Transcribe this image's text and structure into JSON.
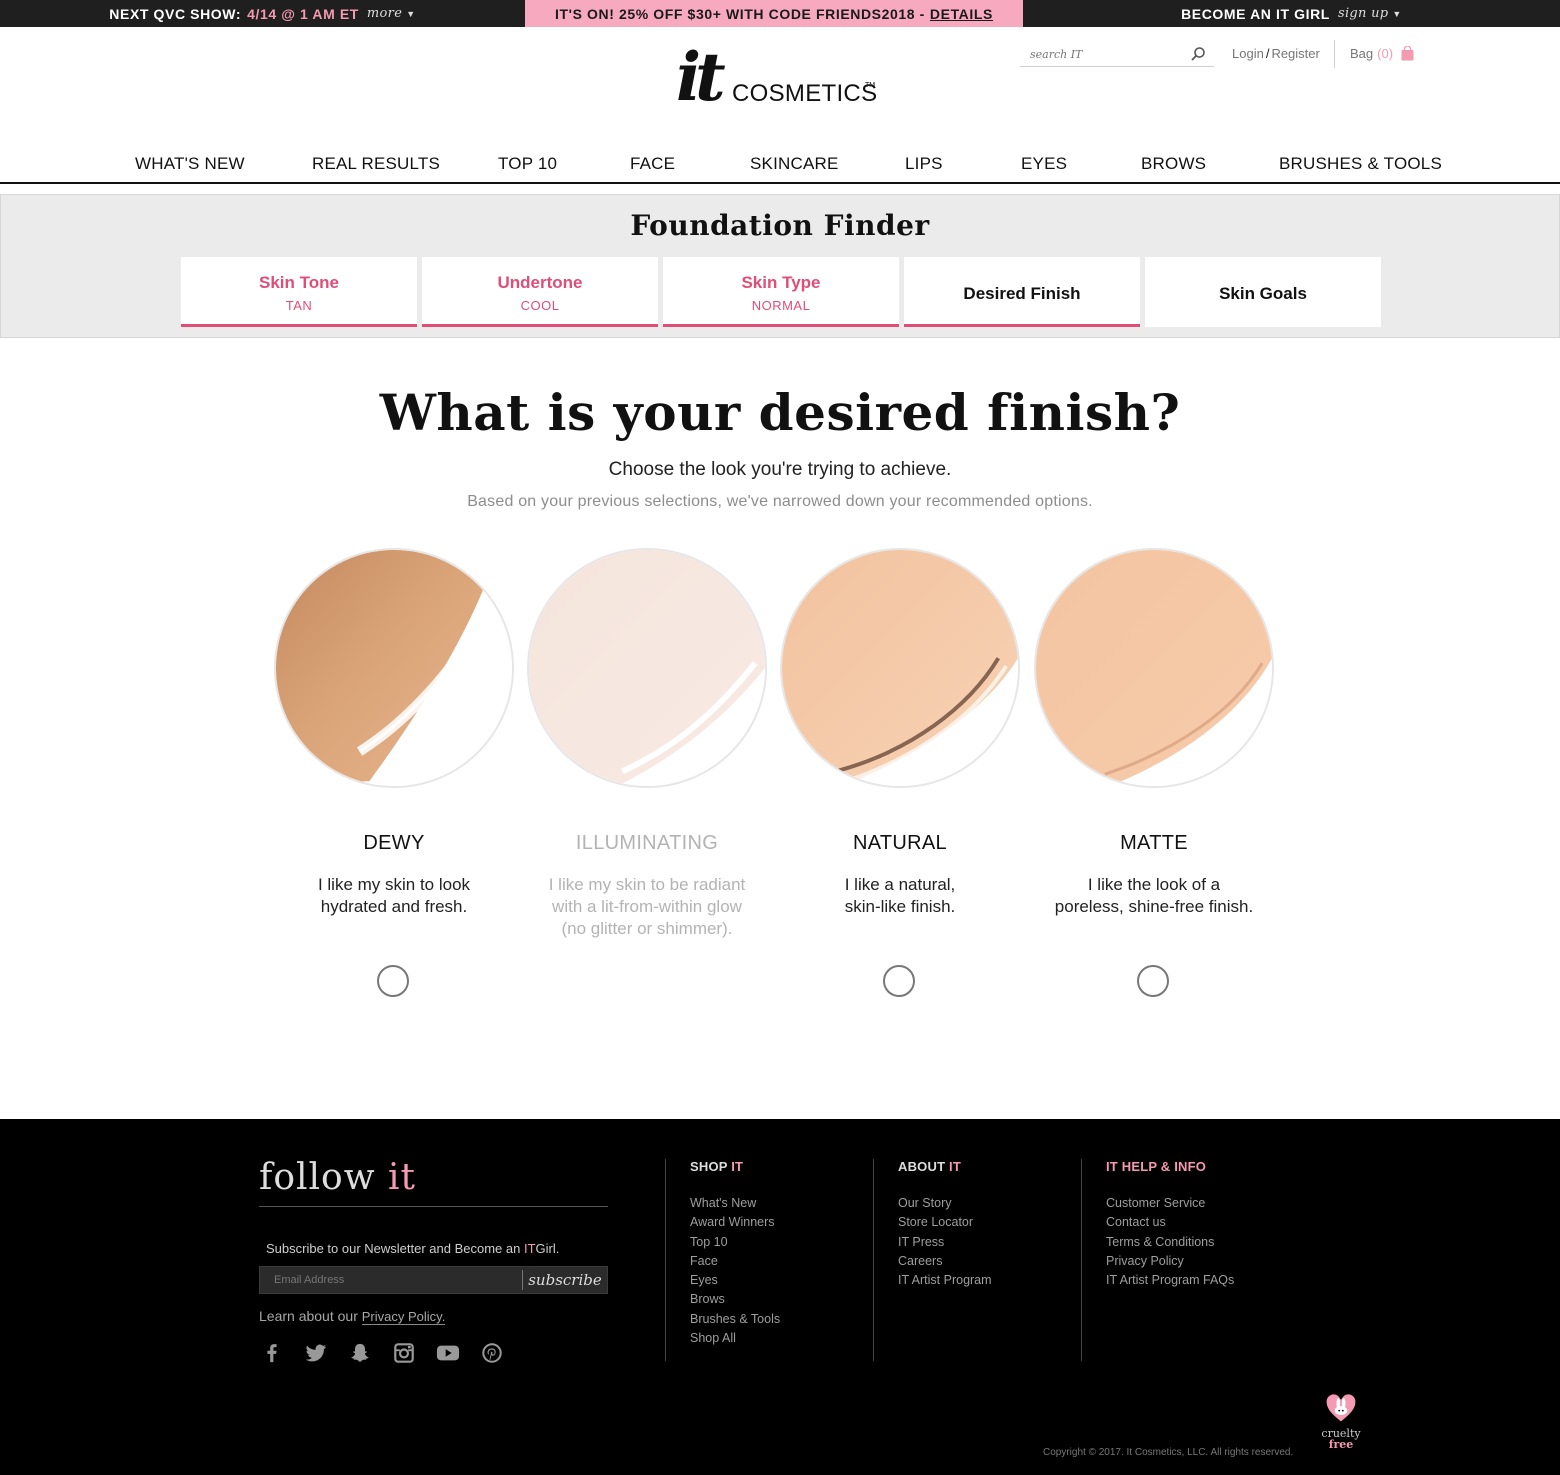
{
  "topbar": {
    "left_label": "Next QVC Show:",
    "left_date": "4/14 @ 1 AM ET",
    "left_more": "more",
    "middle_text": "It's on! 25% off $30+ with code FRIENDS2018 -",
    "middle_link": "Details",
    "right_label": "Become an IT Girl",
    "right_signup": "sign up"
  },
  "header": {
    "logo_it": "it",
    "logo_name": "COSMETICS",
    "logo_tm": "TM",
    "search_placeholder": "search IT",
    "login": "Login",
    "login_sep": "/",
    "register": "Register",
    "bag_label": "Bag",
    "bag_count": "(0)"
  },
  "nav": [
    "WHAT'S NEW",
    "REAL RESULTS",
    "TOP 10",
    "FACE",
    "SKINCARE",
    "LIPS",
    "EYES",
    "BROWS",
    "BRUSHES & TOOLS"
  ],
  "finder": {
    "title": "Foundation Finder",
    "steps": [
      {
        "label": "Skin Tone",
        "value": "TAN",
        "state": "done"
      },
      {
        "label": "Undertone",
        "value": "COOL",
        "state": "done"
      },
      {
        "label": "Skin Type",
        "value": "NORMAL",
        "state": "done"
      },
      {
        "label": "Desired Finish",
        "value": "",
        "state": "current"
      },
      {
        "label": "Skin Goals",
        "value": "",
        "state": "todo"
      }
    ]
  },
  "question": {
    "title": "What is your desired finish?",
    "subtitle": "Choose the look you're trying to achieve.",
    "note": "Based on your previous selections, we've narrowed down your recommended options."
  },
  "options": [
    {
      "name": "DEWY",
      "desc_line1": "I like my skin to look",
      "desc_line2": "hydrated and fresh.",
      "desc_line3": "",
      "enabled": true
    },
    {
      "name": "ILLUMINATING",
      "desc_line1": "I like my skin to be radiant",
      "desc_line2": "with a lit-from-within glow",
      "desc_line3": "(no glitter or shimmer).",
      "enabled": false
    },
    {
      "name": "NATURAL",
      "desc_line1": "I like a natural,",
      "desc_line2": "skin-like finish.",
      "desc_line3": "",
      "enabled": true
    },
    {
      "name": "MATTE",
      "desc_line1": "I like the look of a",
      "desc_line2": "poreless, shine-free finish.",
      "desc_line3": "",
      "enabled": true
    }
  ],
  "footer": {
    "follow": "follow",
    "follow_it": "it",
    "newsletter_pre": "Subscribe to our Newsletter and Become an",
    "newsletter_it": "IT",
    "newsletter_post": "Girl.",
    "email_placeholder": "Email Address",
    "subscribe": "subscribe",
    "privacy_pre": "Learn about our",
    "privacy_link": "Privacy Policy.",
    "social": [
      "facebook-icon",
      "twitter-icon",
      "snapchat-icon",
      "instagram-icon",
      "youtube-icon",
      "pinterest-icon"
    ],
    "columns": [
      {
        "title_pre": "SHOP",
        "title_it": "IT",
        "links": [
          "What's New",
          "Award Winners",
          "Top 10",
          "Face",
          "Eyes",
          "Brows",
          "Brushes & Tools",
          "Shop All"
        ]
      },
      {
        "title_pre": "ABOUT",
        "title_it": "IT",
        "links": [
          "Our Story",
          "Store Locator",
          "IT Press",
          "Careers",
          "IT Artist Program"
        ]
      },
      {
        "title_pre": "IT HELP & INFO",
        "title_it": "",
        "links": [
          "Customer Service",
          "Contact us",
          "Terms & Conditions",
          "Privacy Policy",
          "IT Artist Program FAQs"
        ]
      }
    ],
    "copyright": "Copyright © 2017. It Cosmetics, LLC. All rights reserved.",
    "cruelty_line1": "cruelty",
    "cruelty_line2": "free"
  },
  "colors": {
    "accent_pink": "#e04d77",
    "promo_pink": "#f6a9bf",
    "footer_bg": "#000000"
  }
}
